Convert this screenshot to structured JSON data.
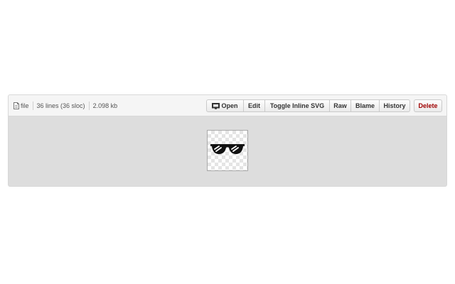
{
  "file_info": {
    "file_label": "file",
    "lines": "36 lines (36 sloc)",
    "size": "2.098 kb"
  },
  "toolbar": {
    "open": "Open",
    "edit": "Edit",
    "toggle_inline_svg": "Toggle Inline SVG",
    "raw": "Raw",
    "blame": "Blame",
    "history": "History",
    "delete": "Delete"
  },
  "colors": {
    "delete_text": "#a00000",
    "viewer_background": "#dddddd",
    "header_background": "#f5f5f5"
  },
  "preview": {
    "icon": "sunglasses-icon"
  }
}
